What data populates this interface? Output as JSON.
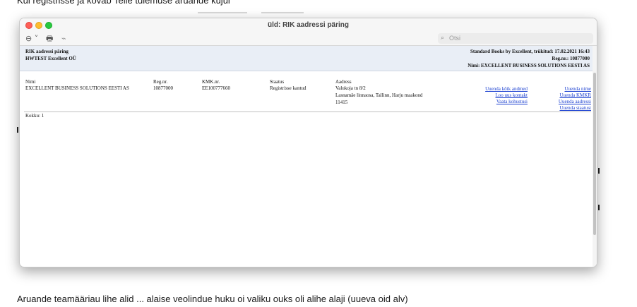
{
  "document": {
    "top_text": "Kui registrisse ja kõvab Teile tulemuse aruande kujul",
    "bottom_text": "Aruande teamääriau lihe alid ... alaise veolindue huku oi valiku ouks oli alihe alaji (uueva oid alv)"
  },
  "window": {
    "title": "üld: RIK aadressi päring",
    "search_placeholder": "Otsi"
  },
  "icons": {
    "more": "⊖ ˅",
    "print": "🖶",
    "attach": "⌁",
    "search": "⌕"
  },
  "report": {
    "header_left": [
      "RIK aadressi päring",
      "HWTEST Excellent OÜ"
    ],
    "header_right": [
      "Standard Books by Excellent, trükitud: 17.02.2021 16:43",
      "Reg.nr.: 10877000",
      "Nimi: EXCELLENT BUSINESS SOLUTIONS EESTI AS"
    ],
    "columns": [
      "Nimi",
      "Reg.nr.",
      "KMK.nr.",
      "Staatus",
      "Aadress"
    ],
    "row": {
      "name": "EXCELLENT BUSINESS SOLUTIONS EESTI AS",
      "regnr": "10877000",
      "kmk": "EE100777660",
      "status": "Registrisse kantud",
      "address": [
        "Valukoja tn 8/2",
        "Lasnamäe linnaosa, Tallinn, Harju maakond",
        "11415"
      ]
    },
    "actions_left": [
      "Uuenda kõik andmed",
      "Loo uus kontakt",
      "Vaata kohustusi"
    ],
    "actions_right": [
      "Uuenda nime",
      "Uuenda KMKR",
      "Uuenda aadressi",
      "Uuenda staatust"
    ],
    "total": "Kokku: 1"
  }
}
